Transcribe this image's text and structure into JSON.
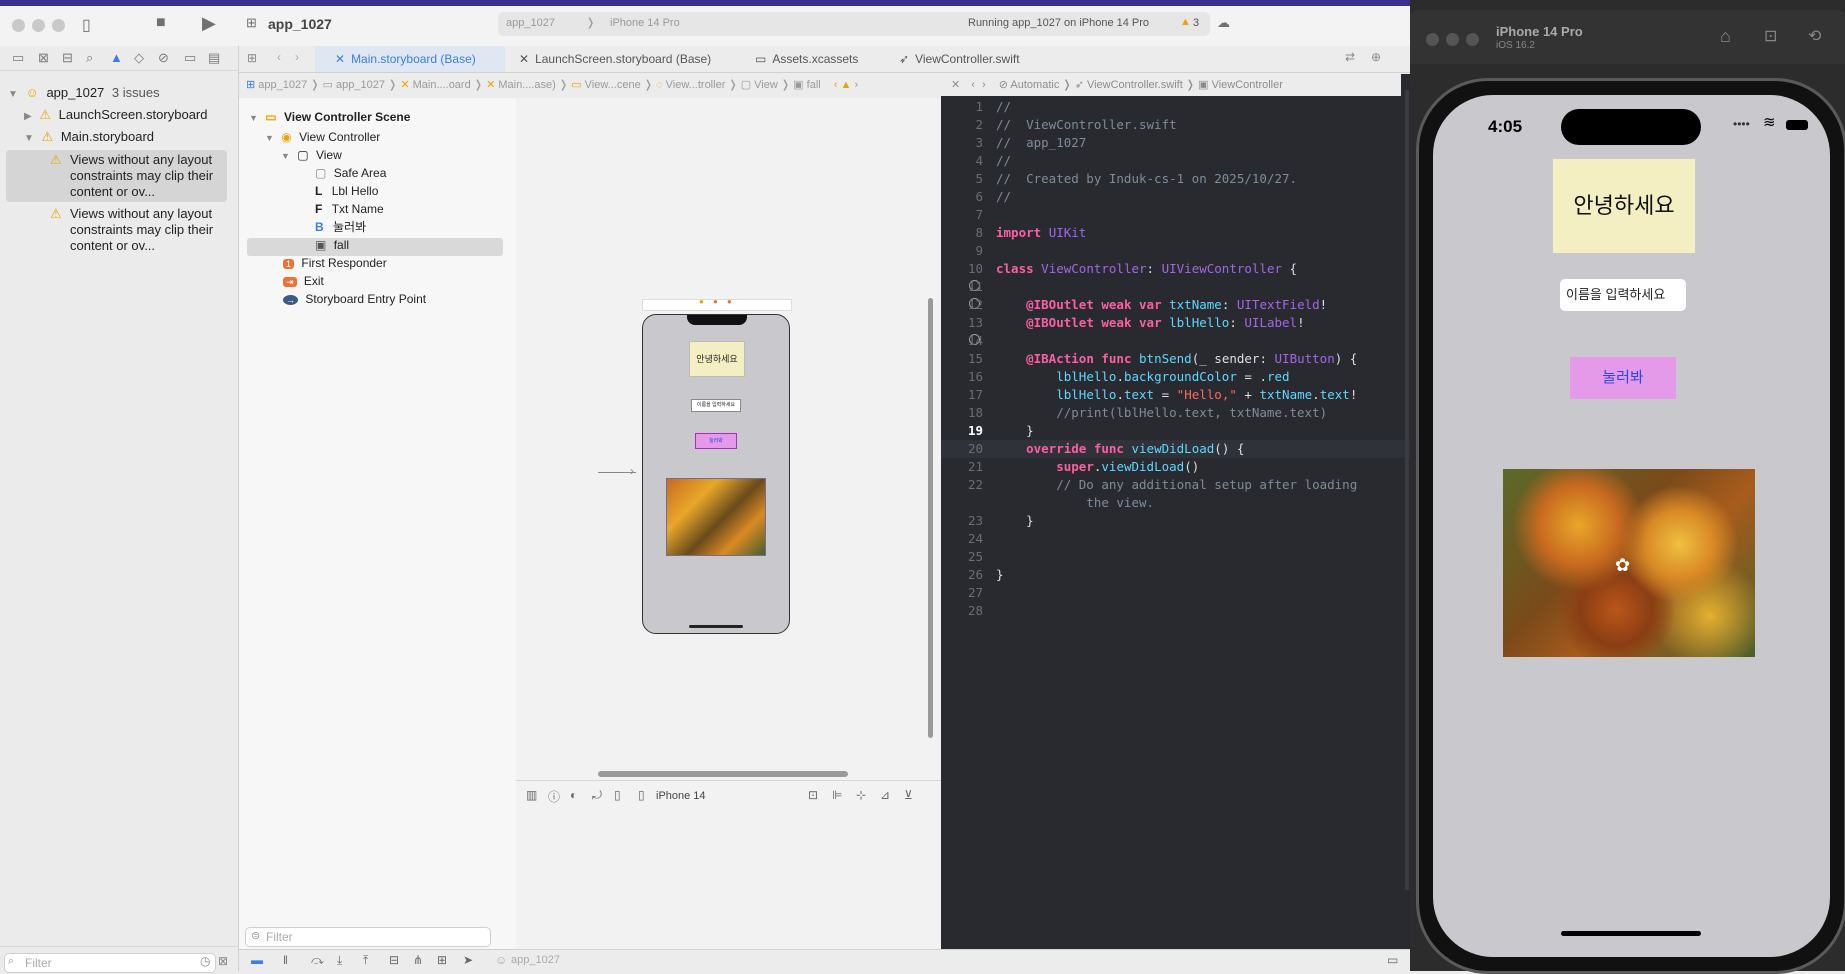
{
  "window": {
    "scheme": "app_1027",
    "destination_scheme": "app_1027",
    "destination_device": "iPhone 14 Pro",
    "status": "Running app_1027 on iPhone 14 Pro",
    "warning_count": "3"
  },
  "navigator": {
    "project_name": "app_1027",
    "project_issues": "3 issues",
    "items": [
      {
        "label": "LaunchScreen.storyboard"
      },
      {
        "label": "Main.storyboard"
      }
    ],
    "issues": [
      {
        "text": "Views without any layout constraints may clip their content or ov..."
      },
      {
        "text": "Views without any layout constraints may clip their content or ov..."
      }
    ],
    "filter_placeholder": "Filter"
  },
  "tabs": [
    {
      "label": "Main.storyboard (Base)"
    },
    {
      "label": "LaunchScreen.storyboard (Base)"
    },
    {
      "label": "Assets.xcassets"
    },
    {
      "label": "ViewController.swift"
    }
  ],
  "jumpbar_left": [
    "app_1027",
    "app_1027",
    "Main....oard",
    "Main....ase)",
    "View...cene",
    "View...troller",
    "View",
    "fall"
  ],
  "jumpbar_right": [
    "Automatic",
    "ViewController.swift",
    "ViewController"
  ],
  "outline": {
    "scene": "View Controller Scene",
    "items": [
      {
        "label": "View Controller"
      },
      {
        "label": "View"
      },
      {
        "label": "Safe Area"
      },
      {
        "label": "Lbl Hello"
      },
      {
        "label": "Txt Name"
      },
      {
        "label": "눌러봐"
      },
      {
        "label": "fall"
      },
      {
        "label": "First Responder"
      },
      {
        "label": "Exit"
      },
      {
        "label": "Storyboard Entry Point"
      }
    ],
    "filter_placeholder": "Filter"
  },
  "canvas": {
    "label_text": "안녕하세요",
    "field_text": "이름을 입력하세요",
    "button_text": "눌러봐",
    "device": "iPhone 14"
  },
  "code": {
    "lines": [
      {
        "n": "1",
        "t": "//"
      },
      {
        "n": "2",
        "t": "//  ViewController.swift"
      },
      {
        "n": "3",
        "t": "//  app_1027"
      },
      {
        "n": "4",
        "t": "//"
      },
      {
        "n": "5",
        "t": "//  Created by Induk-cs-1 on 2025/10/27."
      },
      {
        "n": "6",
        "t": "//"
      },
      {
        "n": "7",
        "t": ""
      },
      {
        "n": "8",
        "t": "import UIKit"
      },
      {
        "n": "9",
        "t": ""
      },
      {
        "n": "10",
        "t": "class ViewController: UIViewController {"
      },
      {
        "n": "11",
        "t": ""
      },
      {
        "n": "12",
        "t": "    @IBOutlet weak var txtName: UITextField!"
      },
      {
        "n": "13",
        "t": "    @IBOutlet weak var lblHello: UILabel!"
      },
      {
        "n": "14",
        "t": ""
      },
      {
        "n": "15",
        "t": "    @IBAction func btnSend(_ sender: UIButton) {"
      },
      {
        "n": "16",
        "t": "        lblHello.backgroundColor = .red"
      },
      {
        "n": "17",
        "t": "        lblHello.text = \"Hello,\" + txtName.text!"
      },
      {
        "n": "18",
        "t": "        //print(lblHello.text, txtName.text)"
      },
      {
        "n": "19",
        "t": "    }"
      },
      {
        "n": "20",
        "t": "    override func viewDidLoad() {"
      },
      {
        "n": "21",
        "t": "        super.viewDidLoad()"
      },
      {
        "n": "22",
        "t": "        // Do any additional setup after loading"
      },
      {
        "n": "",
        "t": "            the view."
      },
      {
        "n": "23",
        "t": "    }"
      },
      {
        "n": "24",
        "t": ""
      },
      {
        "n": "25",
        "t": ""
      },
      {
        "n": "26",
        "t": "}"
      },
      {
        "n": "27",
        "t": ""
      },
      {
        "n": "28",
        "t": ""
      }
    ]
  },
  "simulator": {
    "device": "iPhone 14 Pro",
    "os": "iOS 16.2",
    "time": "4:05",
    "label_text": "안녕하세요",
    "field_placeholder": "이름을 입력하세요",
    "button_text": "눌러봐"
  },
  "colors": {
    "accent": "#3c7de0",
    "warning": "#e8a400",
    "editor_bg": "#292a30",
    "label_bg": "#f3efc2",
    "button_bg": "#e49ae8"
  }
}
